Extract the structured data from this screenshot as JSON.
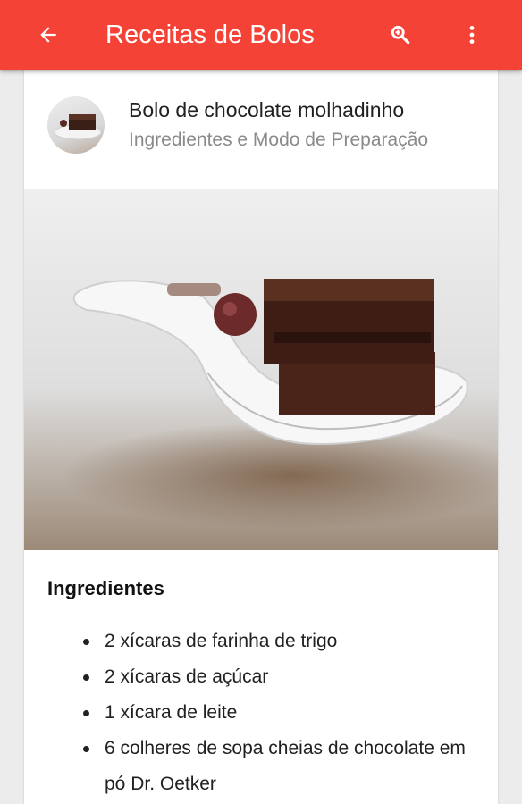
{
  "appbar": {
    "title": "Receitas de Bolos",
    "color": "#f44336",
    "icons": [
      "back-arrow-icon",
      "search-icon",
      "more-vert-icon"
    ]
  },
  "card": {
    "title": "Bolo de chocolate molhadinho",
    "subtitle": "Ingredientes e Modo de Preparação",
    "image": "chocolate-cake-on-white-spoon"
  },
  "ingredients": {
    "heading": "Ingredientes",
    "items": [
      "2 xícaras de farinha de trigo",
      "2 xícaras de açúcar",
      "1 xícara de leite",
      "6 colheres de sopa cheias de chocolate em pó Dr. Oetker"
    ]
  }
}
